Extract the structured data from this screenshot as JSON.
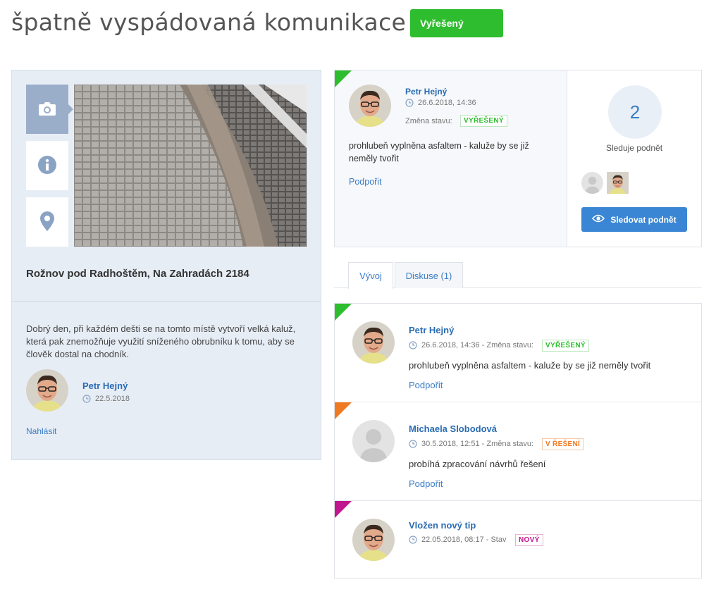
{
  "header": {
    "title": "špatně vyspádovaná komunikace",
    "status": "Vyřešený",
    "status_color": "#2ebd2e"
  },
  "left_panel": {
    "side_tabs": [
      {
        "icon": "camera-icon"
      },
      {
        "icon": "info-icon"
      },
      {
        "icon": "location-pin-icon"
      }
    ],
    "address": "Rožnov pod Radhoštěm, Na Zahradách 2184",
    "description": "Dobrý den, při každém dešti se na tomto místě vytvoří velká kaluž, která pak znemožňuje využití sníženého obrubníku k tomu, aby se člověk dostal na chodník.",
    "author": {
      "name": "Petr Hejný",
      "date": "22.5.2018"
    },
    "report_link": "Nahlásit"
  },
  "latest_update": {
    "author": "Petr Hejný",
    "date": "26.6.2018, 14:36",
    "state_change_label": "Změna stavu:",
    "state": "VYŘEŠENÝ",
    "text": "prohlubeň vyplněna asfaltem - kaluže by se již neměly tvořit",
    "support_link": "Podpořit"
  },
  "followers": {
    "count": "2",
    "label": "Sleduje podnět",
    "button": "Sledovat podnět"
  },
  "tabs": [
    {
      "label": "Vývoj"
    },
    {
      "label": "Diskuse (1)"
    }
  ],
  "timeline": [
    {
      "corner_color": "#2ebd2e",
      "author": "Petr Hejný",
      "meta": "26.6.2018, 14:36 - Změna stavu:",
      "state": "VYŘEŠENÝ",
      "text": "prohlubeň vyplněna asfaltem - kaluže by se již neměly tvořit",
      "link": "Podpořit"
    },
    {
      "corner_color": "#f07a21",
      "author": "Michaela Slobodová",
      "meta": "30.5.2018, 12:51 - Změna stavu:",
      "state": "V ŘEŠENÍ",
      "text": "probíhá zpracování návrhů řešení",
      "link": "Podpořit"
    },
    {
      "corner_color": "#c0168e",
      "author": "Vložen nový tip",
      "meta": "22.05.2018, 08:17 - Stav",
      "state": "NOVÝ"
    }
  ]
}
